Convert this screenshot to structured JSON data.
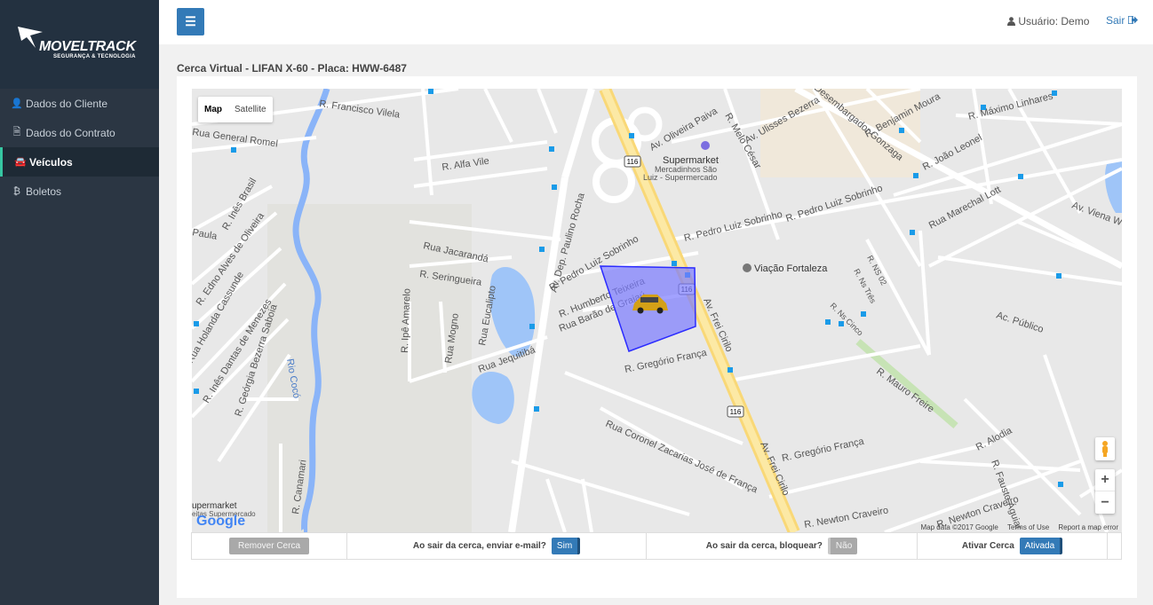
{
  "brand": {
    "name": "MOVELTRACK",
    "tagline": "SEGURANÇA & TECNOLOGIA"
  },
  "sidebar": {
    "items": [
      {
        "label": "Dados do Cliente",
        "icon": "user-icon",
        "glyph": "👤",
        "active": false
      },
      {
        "label": "Dados do Contrato",
        "icon": "file-icon",
        "glyph": "🗎",
        "active": false
      },
      {
        "label": "Veículos",
        "icon": "car-icon",
        "glyph": "🚘",
        "active": true
      },
      {
        "label": "Boletos",
        "icon": "bitcoin-icon",
        "glyph": "₿",
        "active": false
      }
    ]
  },
  "header": {
    "menu_icon": "☰",
    "user_label": "Usuário: Demo",
    "logout_label": "Sair"
  },
  "breadcrumb": "Cerca Virtual  -  LIFAN X-60  -  Placa: HWW-6487",
  "map": {
    "type_map": "Map",
    "type_satellite": "Satellite",
    "zoom_in": "+",
    "zoom_out": "−",
    "footer_data": "Map data ©2017 Google",
    "footer_terms": "Terms of Use",
    "footer_report": "Report a map error",
    "google": "Google",
    "labels": {
      "francisco_vilela": "R. Francisco Vilela",
      "general_romel": "Rua General Romel",
      "alfa_vile": "R. Alfa Vile",
      "oliveira_paiva": "Av. Oliveira Paiva",
      "melo_cesar": "R. Melo César",
      "ulisses_bezerra": "Av. Ulisses Bezerra",
      "benjamin_moura": "R. Benjamin Moura",
      "maximo_linhares": "R. Máximo Linhares",
      "joao_leonel": "R. João Leonel",
      "marechal_lott": "Rua Marechal Lott",
      "viena": "Av. Viena W",
      "supermarket": "Supermarket",
      "mercadinhos": "Mercadinhos São",
      "luiz_super": "Luiz - Supermercado",
      "pedro_luiz_1": "R. Pedro Luiz Sobrinho",
      "pedro_luiz_2": "R. Pedro Luiz Sobrinho",
      "pedro_luiz_3": "R. Pedro Luiz Sobrinho",
      "viacao": "Viação Fortaleza",
      "jacaranda": "Rua Jacarandá",
      "seringueira": "R. Seringueira",
      "ipe_amarelo": "R. Ipê Amarelo",
      "mogno": "Rua Mogno",
      "eucalipto": "Rua Eucalipto",
      "jequitiba": "Rua Jequitibá",
      "paulino_rocha": "Av. Dep. Paulino Rocha",
      "humberto": "R. Humberto Teixeira",
      "barao": "Rua Barão de Grajaú",
      "frei_cirilo": "Av. Frei Cirilo",
      "frei_cirilo_2": "Av. Frei Cirilo",
      "gregorio": "R. Gregório França",
      "gregorio_2": "R. Gregório França",
      "zacarias": "Rua Coronel Zacarias José de França",
      "mauro_freire": "R. Mauro Freire",
      "ac_publico": "Ac. Público",
      "alodia": "R. Alodia",
      "fausto": "R. Fausto Águiar",
      "newton": "R. Newton Craveiro",
      "newton_2": "R. Newton Craveiro",
      "rio_coco": "Rio Cocó",
      "paula": "Paula",
      "ines_brasil": "R. Inês Brasil",
      "edno": "R. Edno Alves de Oliveira",
      "holanda": "Rua Holanda Cassunde",
      "ines_dantas": "R. Inês Dantas de Menezes",
      "georgia": "R. Geórgia Bezerra Saboia",
      "canamari": "R. Canamari",
      "supermarket_2": "upermarket",
      "supermercado_2": "eitas Supermercado",
      "ns02": "R. NS 02",
      "ns_tres": "R. Ns Três",
      "ns_cinco": "R. Ns Cinco",
      "hwy": "116",
      "desembargador": "Desembargador Gonzaga"
    }
  },
  "controls": {
    "remove_fence": "Remover Cerca",
    "email_label": "Ao sair da cerca, enviar e-mail?",
    "email_value": "Sim",
    "block_label": "Ao sair da cerca, bloquear?",
    "block_value": "Não",
    "activate_label": "Ativar Cerca",
    "activate_value": "Ativada"
  },
  "colors": {
    "sidebar": "#2b3643",
    "accent": "#337ab7",
    "active_border": "#36c6a2",
    "fence_fill": "#7b7bff"
  }
}
